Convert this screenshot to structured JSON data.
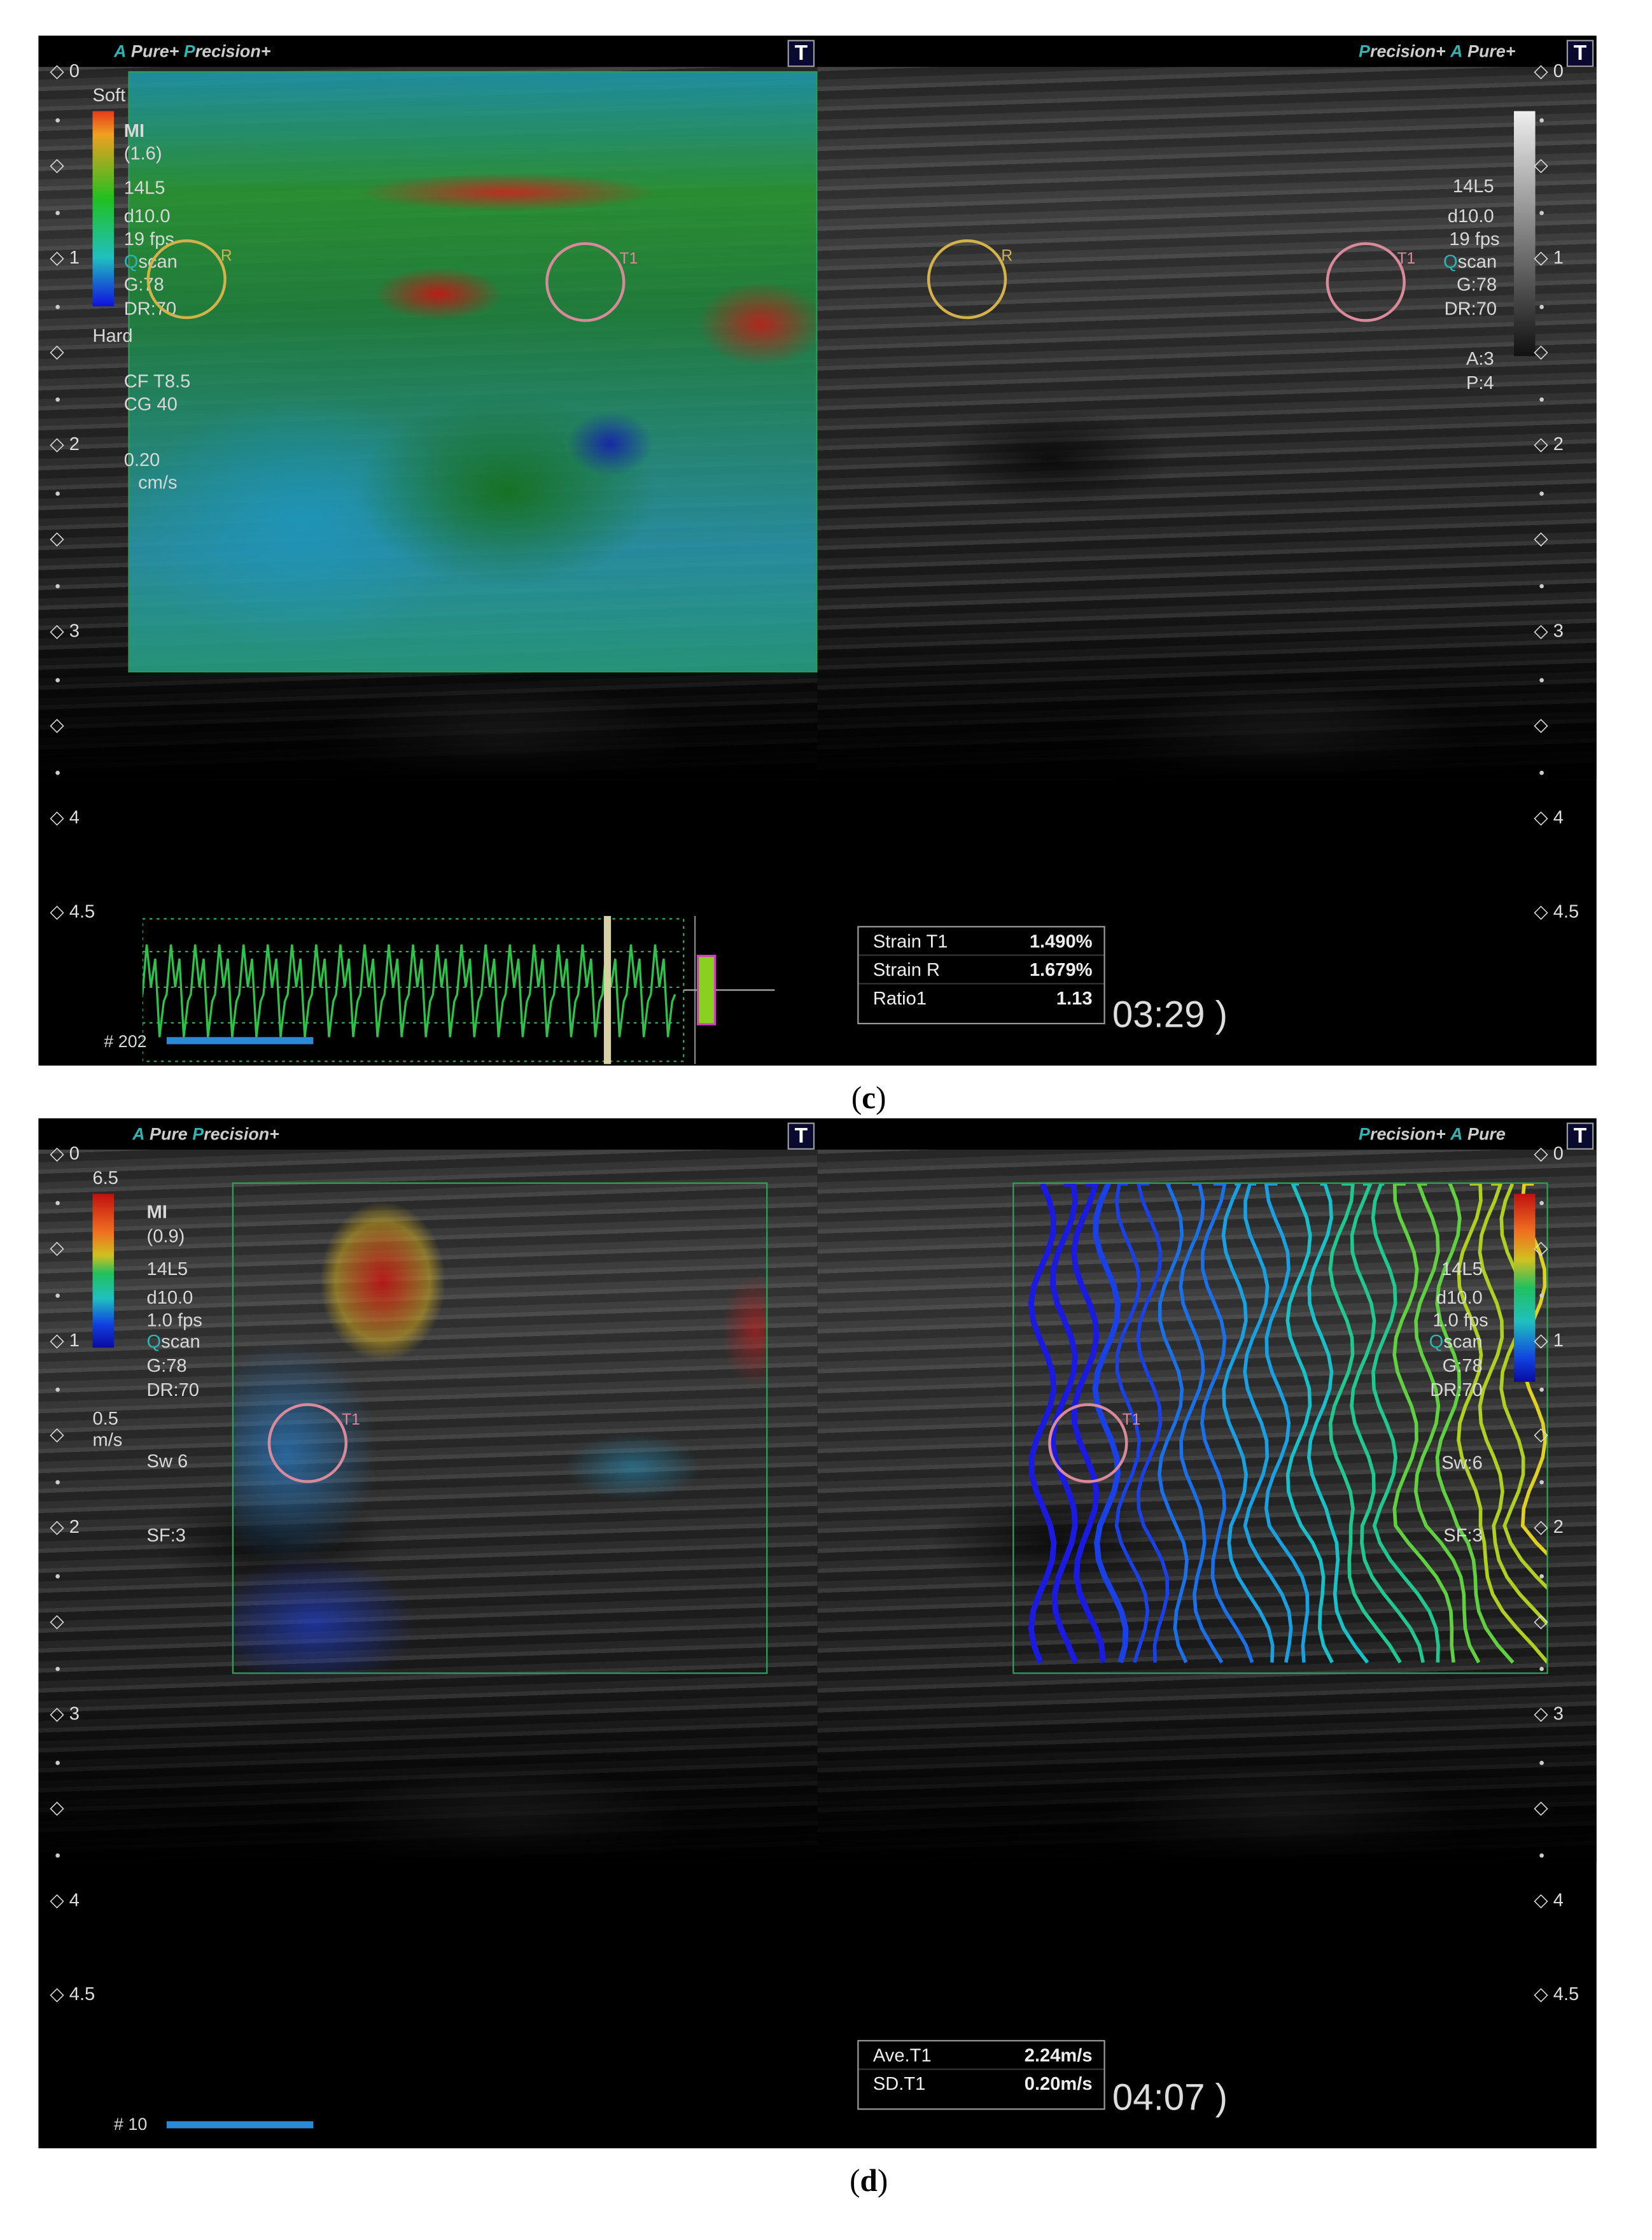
{
  "panels": {
    "c": {
      "caption_open": "(",
      "caption_letter": "c",
      "caption_close": ")",
      "left_brand": {
        "a": "A",
        "pure": "Pure+",
        "p": "P",
        "precision": "recision+"
      },
      "right_brand": {
        "p": "P",
        "precision": "recision+",
        "a": "A",
        "pure": "Pure+"
      },
      "t_icon": "T",
      "depth_labels": [
        "0",
        "1",
        "2",
        "3",
        "4",
        "4.5"
      ],
      "left_params": {
        "soft": "Soft",
        "mi": "MI",
        "mi_val": "(1.6)",
        "probe": "14L5",
        "d": "d10.0",
        "fps": "19 fps",
        "qscan_q": "Q",
        "qscan": "scan",
        "gain": "G:78",
        "dr": "DR:70",
        "hard": "Hard",
        "cf": "CF T8.5",
        "cg": "CG 40",
        "scale": "0.20",
        "unit": "cm/s"
      },
      "right_params": {
        "probe": "14L5",
        "d": "d10.0",
        "fps": "19 fps",
        "qscan_q": "Q",
        "qscan": "scan",
        "gain": "G:78",
        "dr": "DR:70",
        "a": "A:3",
        "p": "P:4"
      },
      "roi_labels": {
        "ref": "R",
        "target": "T1"
      },
      "frame": "# 202",
      "measurements": [
        {
          "label": "Strain T1",
          "value": "1.490%"
        },
        {
          "label": "Strain R",
          "value": "1.679%"
        },
        {
          "label": "Ratio1",
          "value": "1.13"
        }
      ],
      "time": "03:29 )"
    },
    "d": {
      "caption_open": "(",
      "caption_letter": "d",
      "caption_close": ")",
      "left_brand": {
        "a": "A",
        "pure": "Pure",
        "p": "P",
        "precision": "recision+"
      },
      "right_brand": {
        "p": "P",
        "precision": "recision+",
        "a": "A",
        "pure": "Pure"
      },
      "t_icon": "T",
      "depth_labels": [
        "0",
        "1",
        "2",
        "3",
        "4",
        "4.5"
      ],
      "left_params": {
        "max": "6.5",
        "mi": "MI",
        "mi_val": "(0.9)",
        "probe": "14L5",
        "d": "d10.0",
        "fps": "1.0 fps",
        "qscan_q": "Q",
        "qscan": "scan",
        "gain": "G:78",
        "dr": "DR:70",
        "min": "0.5",
        "unit": "m/s",
        "sw": "Sw 6",
        "sf": "SF:3"
      },
      "right_params": {
        "probe": "14L5",
        "d": "d10.0",
        "fps": "1.0 fps",
        "qscan_q": "Q",
        "qscan": "scan",
        "gain": "G:78",
        "dr": "DR:70",
        "sw": "Sw:6",
        "sf": "SF:3"
      },
      "roi_labels": {
        "target": "T1"
      },
      "frame": "# 10",
      "measurements": [
        {
          "label": "Ave.T1",
          "value": "2.24m/s"
        },
        {
          "label": "SD.T1",
          "value": "0.20m/s"
        }
      ],
      "time": "04:07 )"
    }
  },
  "colors": {
    "accent": "#2fb3b3",
    "roi_ref": "#d4b24a",
    "roi_target": "#d98a9a",
    "box": "#2da35a"
  }
}
